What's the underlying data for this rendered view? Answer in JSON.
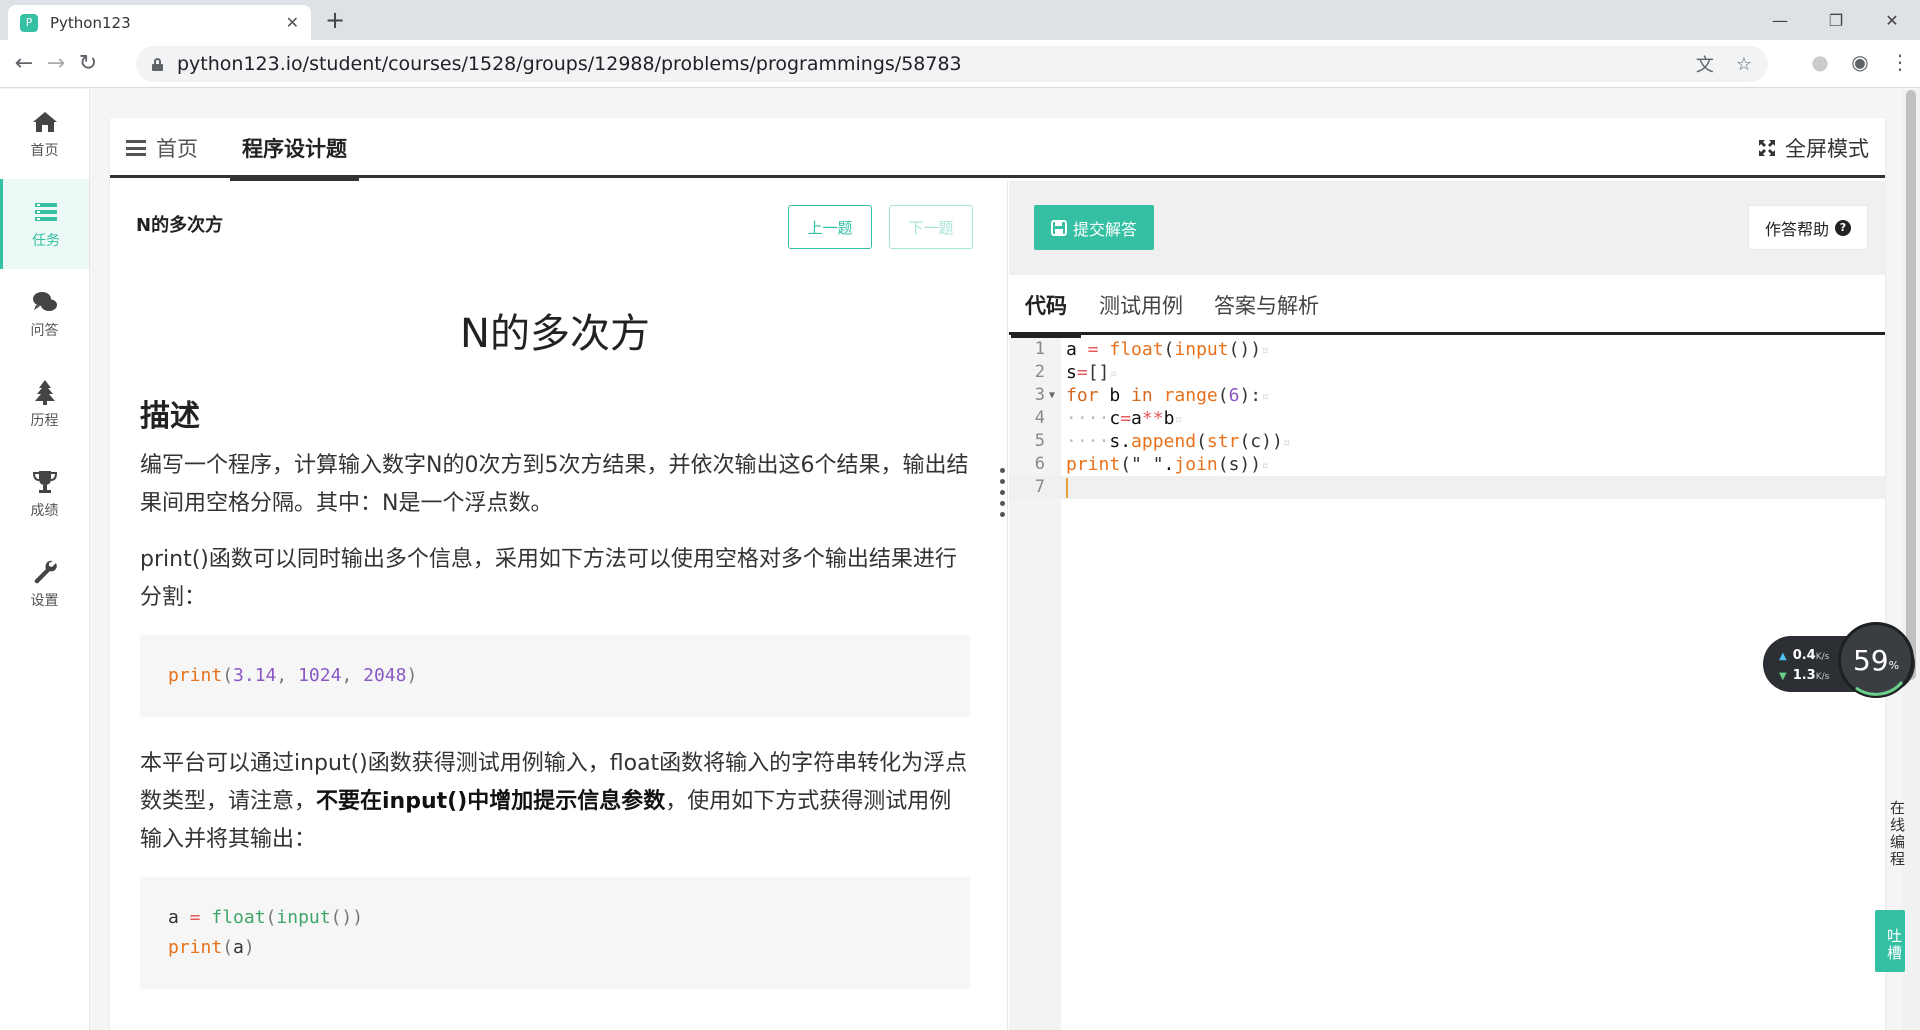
{
  "browser": {
    "tab_title": "Python123",
    "favicon_text": "P",
    "url": "python123.io/student/courses/1528/groups/12988/problems/programmings/58783",
    "accent": "#35c0a4"
  },
  "sidebar": {
    "items": [
      {
        "label": "首页",
        "icon": "home-icon"
      },
      {
        "label": "任务",
        "icon": "tasks-icon",
        "active": true
      },
      {
        "label": "问答",
        "icon": "chat-icon"
      },
      {
        "label": "历程",
        "icon": "tree-icon"
      },
      {
        "label": "成绩",
        "icon": "trophy-icon"
      },
      {
        "label": "设置",
        "icon": "wrench-icon"
      }
    ]
  },
  "card": {
    "tab_home": "首页",
    "tab_prog": "程序设计题",
    "fullscreen": "全屏模式"
  },
  "problem": {
    "small_title": "N的多次方",
    "prev": "上一题",
    "next": "下一题",
    "title": "N的多次方",
    "heading": "描述",
    "p1": "编写一个程序，计算输入数字N的0次方到5次方结果，并依次输出这6个结果，输出结果间用空格分隔。其中：N是一个浮点数。",
    "p2": "print()函数可以同时输出多个信息，采用如下方法可以使用空格对多个输出结果进行分割：",
    "code1": {
      "fn": "print",
      "open": "(",
      "n1": "3.14",
      "sep": ", ",
      "n2": "1024",
      "n3": "2048",
      "close": ")"
    },
    "p3_a": "本平台可以通过input()函数获得测试用例输入，float函数将输入的字符串转化为浮点数类型，请注意，",
    "p3_b": "不要在input()中增加提示信息参数",
    "p3_c": "，使用如下方式获得测试用例输入并将其输出：",
    "code2": {
      "l1_var": "a",
      "l1_eq": " = ",
      "l1_fn": "float",
      "l1_open": "(",
      "l1_fn2": "input",
      "l1_close": "())",
      "l2_fn": "print",
      "l2_open": "(",
      "l2_arg": "a",
      "l2_close": ")"
    }
  },
  "editor": {
    "submit": "提交解答",
    "help": "作答帮助",
    "help_mark": "?",
    "tabs": [
      "代码",
      "测试用例",
      "答案与解析"
    ],
    "lines": [
      {
        "n": "1"
      },
      {
        "n": "2"
      },
      {
        "n": "3"
      },
      {
        "n": "4"
      },
      {
        "n": "5"
      },
      {
        "n": "6"
      },
      {
        "n": "7"
      }
    ],
    "tok": {
      "l1": [
        "a",
        " = ",
        "float",
        "(",
        "input",
        "())"
      ],
      "l2": [
        "s",
        "=",
        "[]"
      ],
      "l3": [
        "for",
        " b ",
        "in",
        " ",
        "range",
        "(",
        "6",
        "):"
      ],
      "l4": [
        "····",
        "c",
        "=",
        "a",
        "**",
        "b"
      ],
      "l5": [
        "····",
        "s",
        ".",
        "append",
        "(",
        "str",
        "(c))"
      ],
      "l6": [
        "print",
        "(\" \"",
        ".",
        "join",
        "(s))"
      ]
    },
    "eol": "¤"
  },
  "netmon": {
    "up": "0.4",
    "down": "1.3",
    "unit": "K/s",
    "percent": "59",
    "percent_sign": "%"
  },
  "floating": {
    "online": "在线编程",
    "feedback": "吐槽"
  }
}
